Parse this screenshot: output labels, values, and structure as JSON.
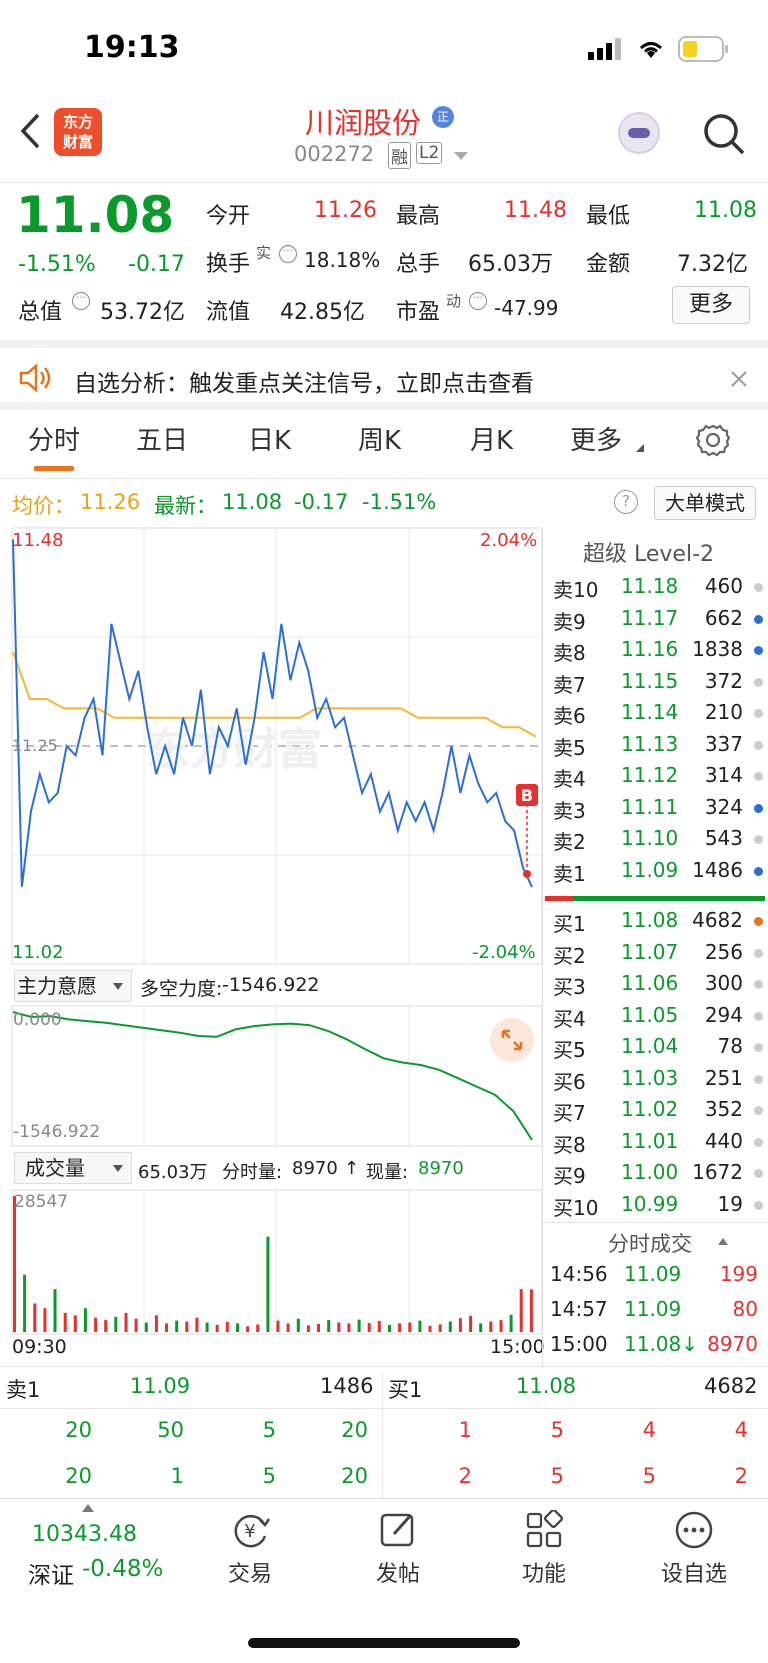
{
  "status": {
    "time": "19:13"
  },
  "header": {
    "name": "川润股份",
    "code": "002272",
    "tag_rong": "融",
    "tag_l2": "L2",
    "logo": "东方\n财富"
  },
  "quote": {
    "price": "11.08",
    "change_pct": "-1.51%",
    "change": "-0.17",
    "open_label": "今开",
    "open": "11.26",
    "high_label": "最高",
    "high": "11.48",
    "low_label": "最低",
    "low": "11.08",
    "turnover_label": "换手",
    "turnover_sup": "实",
    "turnover": "18.18%",
    "volume_label": "总手",
    "volume": "65.03万",
    "amount_label": "金额",
    "amount": "7.32亿",
    "mcap_label": "总值",
    "mcap": "53.72亿",
    "float_label": "流值",
    "float": "42.85亿",
    "pe_label": "市盈",
    "pe_sup": "动",
    "pe": "-47.99",
    "more": "更多"
  },
  "banner": {
    "text": "自选分析：触发重点关注信号，立即点击查看"
  },
  "tabs": [
    "分时",
    "五日",
    "日K",
    "周K",
    "月K",
    "更多"
  ],
  "info": {
    "avg_label": "均价：",
    "avg": "11.26",
    "latest_label": "最新：",
    "latest": "11.08",
    "chg": "-0.17",
    "pct": "-1.51%",
    "mode": "大单模式"
  },
  "chart": {
    "y_high": "11.48",
    "y_low": "11.02",
    "y_mid": "11.25",
    "pct_high": "2.04%",
    "pct_low": "-2.04%",
    "marker": "B",
    "indicator_label": "主力意愿",
    "indicator_field": "多空力度:",
    "indicator_value": "-1546.922",
    "ind_top": "0.000",
    "ind_bottom": "-1546.922",
    "vol_label": "成交量",
    "vol_total": "65.03万",
    "vol_min_label": "分时量:",
    "vol_min": "8970",
    "vol_now_label": "现量:",
    "vol_now": "8970",
    "vol_max": "28547",
    "t_start": "09:30",
    "t_end": "15:00"
  },
  "chart_data": {
    "type": "line",
    "ylim": [
      11.02,
      11.48
    ],
    "series": [
      {
        "values": [
          11.47,
          11.1,
          11.18,
          11.22,
          11.19,
          11.2,
          11.25,
          11.24,
          11.28,
          11.3,
          11.24,
          11.38,
          11.34,
          11.3,
          11.33,
          11.27,
          11.22,
          11.25,
          11.22,
          11.28,
          11.25,
          11.31,
          11.22,
          11.27,
          11.25,
          11.29,
          11.23,
          11.28,
          11.35,
          11.3,
          11.38,
          11.32,
          11.36,
          11.33,
          11.28,
          11.3,
          11.27,
          11.28,
          11.24,
          11.2,
          11.22,
          11.18,
          11.2,
          11.16,
          11.19,
          11.17,
          11.19,
          11.16,
          11.2,
          11.25,
          11.2,
          11.24,
          11.21,
          11.19,
          11.2,
          11.17,
          11.16,
          11.12,
          11.1
        ]
      },
      {
        "values": [
          11.35,
          11.3,
          11.3,
          11.29,
          11.29,
          11.29,
          11.28,
          11.28,
          11.28,
          11.28,
          11.28,
          11.28,
          11.28,
          11.28,
          11.28,
          11.28,
          11.28,
          11.28,
          11.29,
          11.29,
          11.29,
          11.29,
          11.29,
          11.29,
          11.28,
          11.28,
          11.28,
          11.28,
          11.28,
          11.27,
          11.27,
          11.26
        ]
      }
    ],
    "indicator": [
      0,
      -60,
      -50,
      -90,
      -110,
      -130,
      -160,
      -190,
      -220,
      -250,
      -290,
      -300,
      -210,
      -170,
      -150,
      -140,
      -160,
      -230,
      -330,
      -450,
      -560,
      -610,
      -640,
      -700,
      -800,
      -900,
      -1000,
      -1200,
      -1546.922
    ],
    "volume": [
      28547,
      12000,
      6000,
      5000,
      9000,
      4000,
      3500,
      5000,
      3000,
      2500,
      3200,
      4000,
      2800,
      2000,
      3500,
      1800,
      2400,
      2200,
      3000,
      2000,
      1500,
      2100,
      1800,
      1200,
      1600,
      20000,
      2400,
      1800,
      2800,
      1400,
      1700,
      2500,
      2000,
      1800,
      2600,
      1900,
      2300,
      1500,
      1800,
      2000,
      2400,
      1300,
      1600,
      2200,
      2900,
      3400,
      1800,
      2200,
      2500,
      3600,
      9000,
      8970
    ]
  },
  "orderbook": {
    "title": "超级 Level-2",
    "asks": [
      {
        "label": "卖10",
        "price": "11.18",
        "vol": "460",
        "dot": "#ccc"
      },
      {
        "label": "卖9",
        "price": "11.17",
        "vol": "662",
        "dot": "#2b6fd6"
      },
      {
        "label": "卖8",
        "price": "11.16",
        "vol": "1838",
        "dot": "#2b6fd6"
      },
      {
        "label": "卖7",
        "price": "11.15",
        "vol": "372",
        "dot": "#ccc"
      },
      {
        "label": "卖6",
        "price": "11.14",
        "vol": "210",
        "dot": "#ccc"
      },
      {
        "label": "卖5",
        "price": "11.13",
        "vol": "337",
        "dot": "#ccc"
      },
      {
        "label": "卖4",
        "price": "11.12",
        "vol": "314",
        "dot": "#ccc"
      },
      {
        "label": "卖3",
        "price": "11.11",
        "vol": "324",
        "dot": "#2b6fd6"
      },
      {
        "label": "卖2",
        "price": "11.10",
        "vol": "543",
        "dot": "#ccc"
      },
      {
        "label": "卖1",
        "price": "11.09",
        "vol": "1486",
        "dot": "#2b6fd6"
      }
    ],
    "bids": [
      {
        "label": "买1",
        "price": "11.08",
        "vol": "4682",
        "dot": "#e8731c"
      },
      {
        "label": "买2",
        "price": "11.07",
        "vol": "256",
        "dot": "#ccc"
      },
      {
        "label": "买3",
        "price": "11.06",
        "vol": "300",
        "dot": "#ccc"
      },
      {
        "label": "买4",
        "price": "11.05",
        "vol": "294",
        "dot": "#ccc"
      },
      {
        "label": "买5",
        "price": "11.04",
        "vol": "78",
        "dot": "#ccc"
      },
      {
        "label": "买6",
        "price": "11.03",
        "vol": "251",
        "dot": "#ccc"
      },
      {
        "label": "买7",
        "price": "11.02",
        "vol": "352",
        "dot": "#ccc"
      },
      {
        "label": "买8",
        "price": "11.01",
        "vol": "440",
        "dot": "#ccc"
      },
      {
        "label": "买9",
        "price": "11.00",
        "vol": "1672",
        "dot": "#ccc"
      },
      {
        "label": "买10",
        "price": "10.99",
        "vol": "19",
        "dot": "#ccc"
      }
    ],
    "ticks_title": "分时成交",
    "ticks": [
      {
        "t": "14:56",
        "p": "11.09",
        "v": "199"
      },
      {
        "t": "14:57",
        "p": "11.09",
        "v": "80"
      },
      {
        "t": "15:00",
        "p": "11.08↓",
        "v": "8970"
      }
    ]
  },
  "depth": {
    "ask_label": "卖1",
    "ask_price": "11.09",
    "ask_vol": "1486",
    "bid_label": "买1",
    "bid_price": "11.08",
    "bid_vol": "4682",
    "ask_row1": [
      "20",
      "50",
      "5",
      "20"
    ],
    "ask_row2": [
      "20",
      "1",
      "5",
      "20"
    ],
    "bid_row1": [
      "1",
      "5",
      "4",
      "4"
    ],
    "bid_row2": [
      "2",
      "5",
      "5",
      "2"
    ]
  },
  "index": {
    "value": "10343.48",
    "name": "深证",
    "pct": "-0.48%"
  },
  "nav": [
    "交易",
    "发帖",
    "功能",
    "设自选"
  ],
  "colors": {
    "red": "#e5302c",
    "green": "#0a9a2b",
    "line": "#2b6fd6",
    "avg": "#f5b731",
    "accent": "#e8731c"
  }
}
